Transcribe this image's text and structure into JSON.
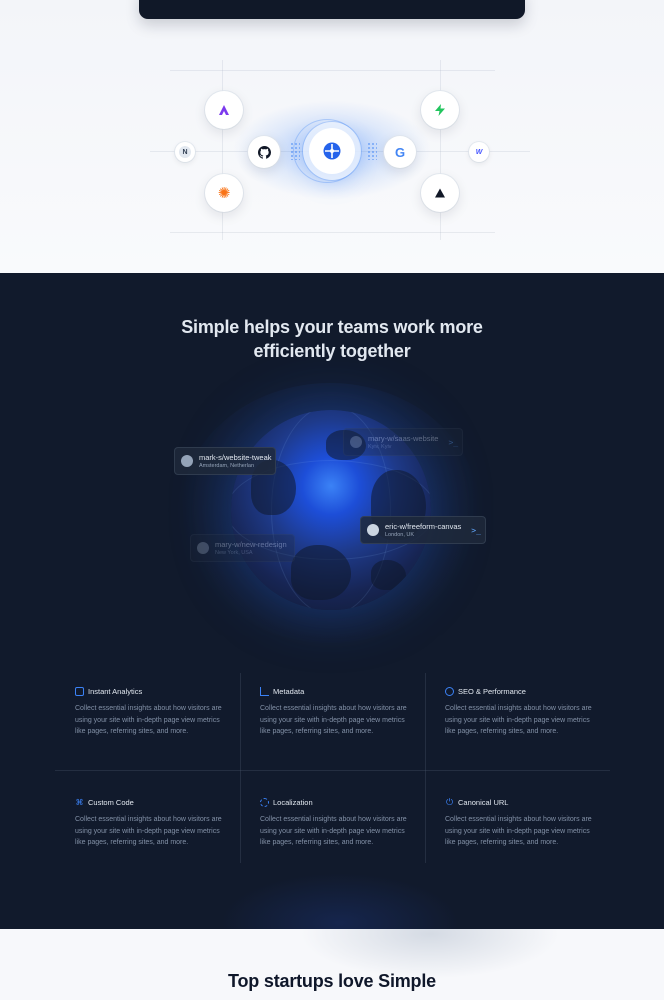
{
  "integrations": {
    "nodes": [
      {
        "name": "framer-icon",
        "glyph": "▲"
      },
      {
        "name": "supabase-icon",
        "glyph": "⚡"
      },
      {
        "name": "notion-icon",
        "glyph": "N"
      },
      {
        "name": "github-icon",
        "glyph": ""
      },
      {
        "name": "google-icon",
        "glyph": "G"
      },
      {
        "name": "webflow-icon",
        "glyph": "W"
      },
      {
        "name": "asterisk-icon",
        "glyph": "✺"
      },
      {
        "name": "vercel-icon",
        "glyph": "▲"
      }
    ]
  },
  "teams": {
    "headline_line1": "Simple helps your teams work more",
    "headline_line2": "efficiently together",
    "chips": [
      {
        "repo": "mark-s/website-tweak",
        "location": "Amsterdam, Netherlan"
      },
      {
        "repo": "mary-w/saas-website",
        "location": "Kyiv, Kyiv"
      },
      {
        "repo": "eric-w/freeform-canvas",
        "location": "London, UK"
      },
      {
        "repo": "mary-w/new-redesign",
        "location": "New York, USA"
      }
    ]
  },
  "features": [
    {
      "title": "Instant Analytics",
      "desc": "Collect essential insights about how visitors are using your site with in-depth page view metrics like pages, referring sites, and more.",
      "icon": "analytics-icon"
    },
    {
      "title": "Metadata",
      "desc": "Collect essential insights about how visitors are using your site with in-depth page view metrics like pages, referring sites, and more.",
      "icon": "metadata-icon"
    },
    {
      "title": "SEO & Performance",
      "desc": "Collect essential insights about how visitors are using your site with in-depth page view metrics like pages, referring sites, and more.",
      "icon": "seo-icon"
    },
    {
      "title": "Custom Code",
      "desc": "Collect essential insights about how visitors are using your site with in-depth page view metrics like pages, referring sites, and more.",
      "icon": "custom-code-icon"
    },
    {
      "title": "Localization",
      "desc": "Collect essential insights about how visitors are using your site with in-depth page view metrics like pages, referring sites, and more.",
      "icon": "localization-icon"
    },
    {
      "title": "Canonical URL",
      "desc": "Collect essential insights about how visitors are using your site with in-depth page view metrics like pages, referring sites, and more.",
      "icon": "canonical-url-icon"
    }
  ],
  "startups": {
    "title": "Top startups love Simple"
  },
  "colors": {
    "accent": "#3b82f6",
    "dark_bg": "#111a2c",
    "light_bg": "#f7f8fb"
  }
}
